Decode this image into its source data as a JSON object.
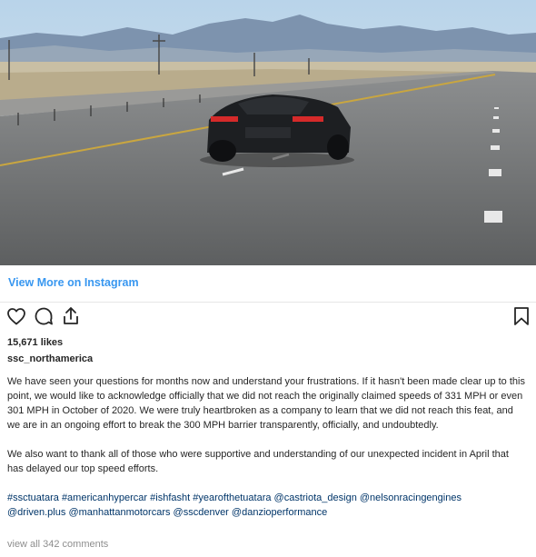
{
  "post": {
    "view_more_label": "View More on Instagram",
    "likes": "15,671 likes",
    "username": "ssc_northamerica",
    "caption_paragraphs": [
      "We have seen your questions for months now and understand your frustrations. If it hasn't been made clear up to this point, we would like to acknowledge officially that we did not reach the originally claimed speeds of 331 MPH or even 301 MPH in October of 2020. We were truly heartbroken as a company to learn that we did not reach this feat, and we are in an ongoing effort to break the 300 MPH barrier transparently, officially, and undoubtedly.",
      "We also want to thank all of those who were supportive and understanding of our unexpected incident in April that has delayed our top speed efforts."
    ],
    "tags": [
      "#ssctuatara",
      "#americanhypercar",
      "#ishfasht",
      "#yearofthetuatara",
      "@castriota_design",
      "@nelsonracingengines",
      "@driven.plus",
      "@manhattanmotorcars",
      "@sscdenver",
      "@danzioperformance"
    ],
    "view_comments": "view all 342 comments"
  },
  "icons": {
    "like": "heart-icon",
    "comment": "comment-bubble-icon",
    "share": "share-icon",
    "save": "bookmark-icon"
  },
  "colors": {
    "link_blue": "#3897f0",
    "tag_blue": "#003569",
    "muted": "#8e8e8e",
    "text": "#262626"
  }
}
